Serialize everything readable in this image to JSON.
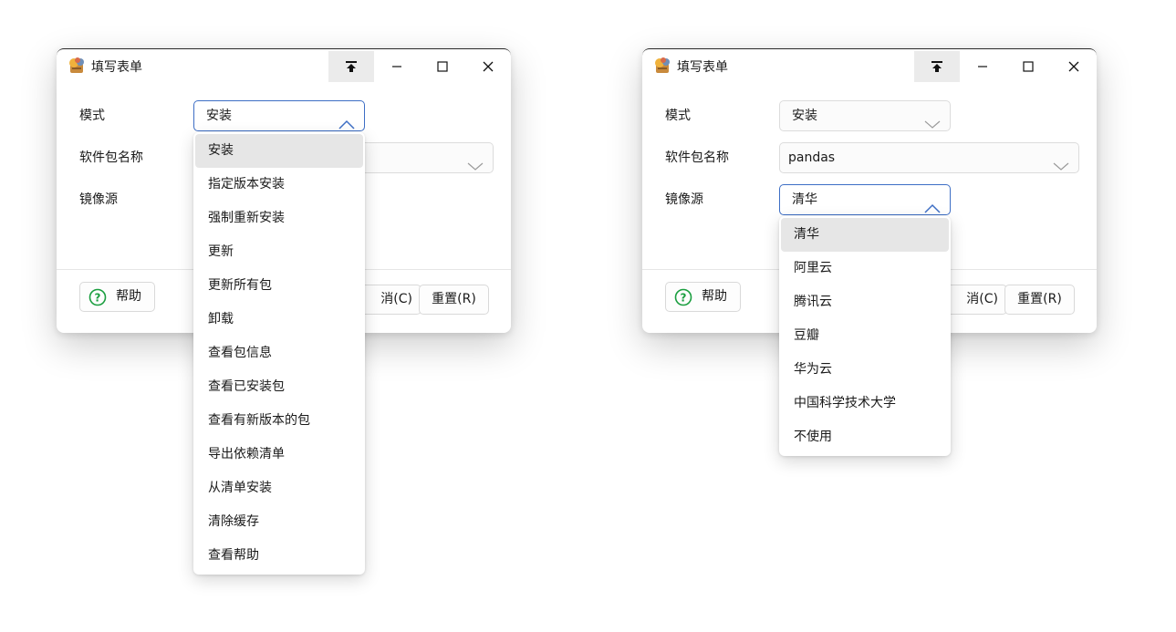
{
  "left_window": {
    "title": "填写表单",
    "fields": {
      "mode_label": "模式",
      "package_label": "软件包名称",
      "mirror_label": "镜像源",
      "mode_value": "安装"
    },
    "buttons": {
      "help": "帮助",
      "cancel_partial": "消(C)",
      "reset": "重置(R)"
    },
    "dropdown_options": [
      "安装",
      "指定版本安装",
      "强制重新安装",
      "更新",
      "更新所有包",
      "卸载",
      "查看包信息",
      "查看已安装包",
      "查看有新版本的包",
      "导出依赖清单",
      "从清单安装",
      "清除缓存",
      "查看帮助"
    ]
  },
  "right_window": {
    "title": "填写表单",
    "fields": {
      "mode_label": "模式",
      "package_label": "软件包名称",
      "mirror_label": "镜像源",
      "mode_value": "安装",
      "package_value": "pandas",
      "mirror_value": "清华"
    },
    "buttons": {
      "help": "帮助",
      "cancel_partial": "消(C)",
      "reset": "重置(R)"
    },
    "dropdown_options": [
      "清华",
      "阿里云",
      "腾讯云",
      "豆瓣",
      "华为云",
      "中国科学技术大学",
      "不使用"
    ]
  },
  "colors": {
    "accent": "#3d6ec5",
    "help_green": "#1a9e3f",
    "selected_bg": "#e6e6e6"
  },
  "icons": [
    "app-icon",
    "pin-icon",
    "minimize-icon",
    "maximize-icon",
    "close-icon",
    "chevron-up-icon",
    "chevron-down-icon",
    "help-circle-icon"
  ]
}
